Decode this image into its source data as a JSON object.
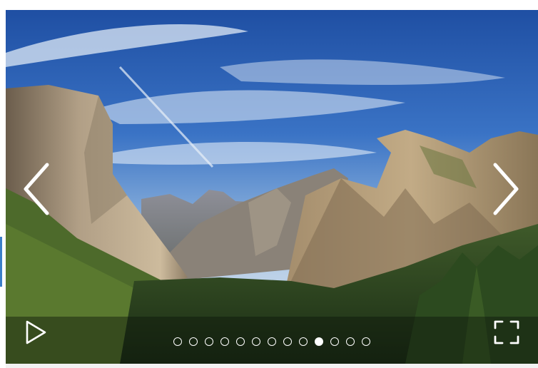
{
  "gallery": {
    "slide_count": 13,
    "active_index": 9
  },
  "controls": {
    "prev_icon": "chevron-left-icon",
    "next_icon": "chevron-right-icon",
    "play_icon": "play-icon",
    "fullscreen_icon": "fullscreen-icon"
  },
  "colors": {
    "control": "#ffffff",
    "accent": "#3b7fc9"
  }
}
